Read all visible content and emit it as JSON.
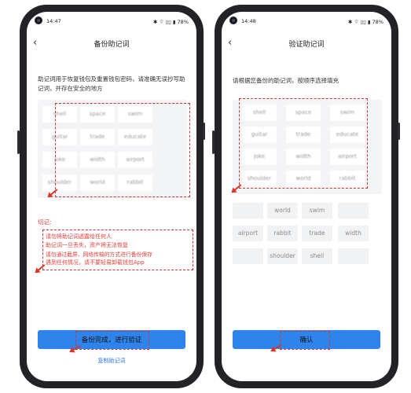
{
  "left": {
    "status": {
      "time": "14:47",
      "icons": "✱ ⌔ ▯▯ ▮ 78%"
    },
    "title": "备份助记词",
    "back": "‹",
    "description": "助记词用于恢复钱包及重置钱包密码，请准确无误抄写助记词，并存在安全的地方",
    "words": [
      "shell",
      "space",
      "swim",
      "guitar",
      "trade",
      "educate",
      "joke",
      "width",
      "airport",
      "shoulder",
      "world",
      "rabbit"
    ],
    "warning_title": "切记:",
    "warnings": [
      "请勿将助记词透露给任何人",
      "助记词一旦丢失，资产将无法恢复",
      "请勿通过截屏、网络传输的方式进行备份保存",
      "遇到任何情况，请不要轻易卸载钱包App"
    ],
    "button": "备份完成，进行验证",
    "link": "复制助记词"
  },
  "right": {
    "status": {
      "time": "14:48",
      "icons": "✱ ⌔ ▯▯ ▮ 78%"
    },
    "title": "验证助记词",
    "back": "‹",
    "description": "请根据您备份的助记词，按顺序选择填充",
    "words": [
      "shell",
      "space",
      "swim",
      "guitar",
      "trade",
      "educate",
      "joke",
      "width",
      "airport",
      "shoulder",
      "world",
      "rabbit"
    ],
    "options": [
      "",
      "world",
      "swim",
      "",
      "airport",
      "rabbit",
      "trade",
      "width",
      "",
      "shoulder",
      "shell",
      ""
    ],
    "button": "确认"
  }
}
